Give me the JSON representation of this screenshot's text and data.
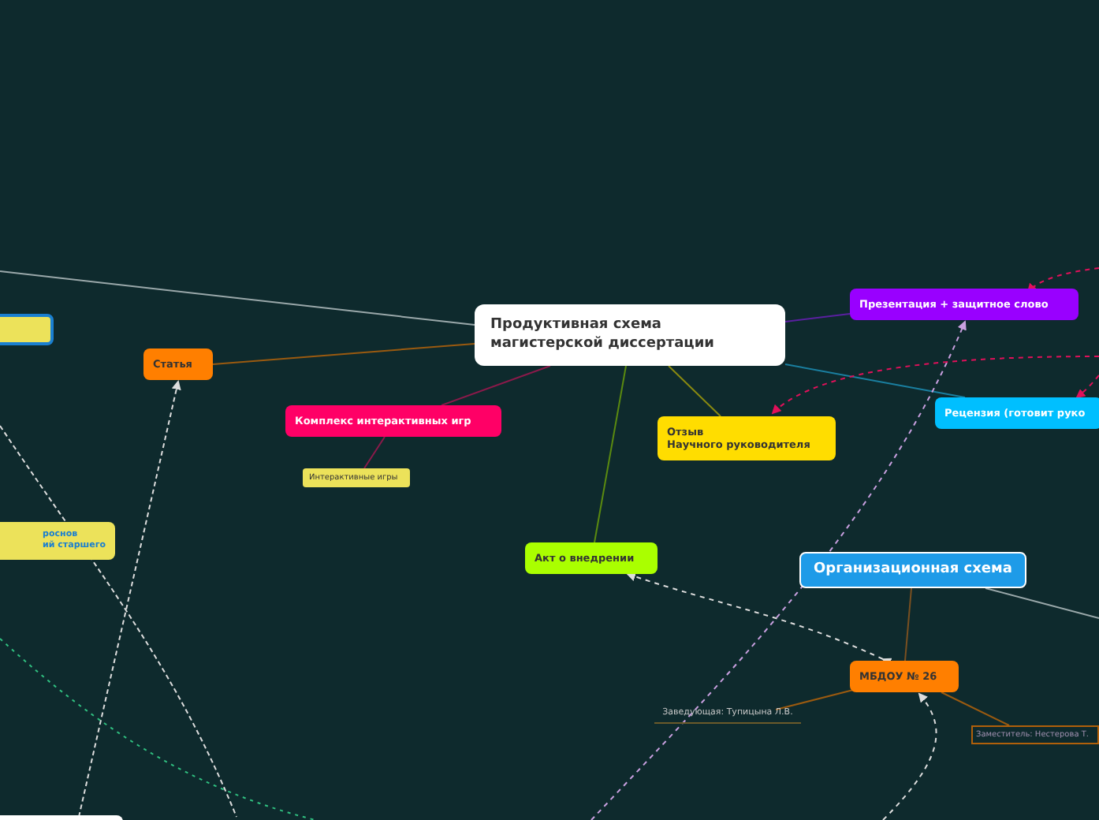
{
  "nodes": [
    {
      "kind": "main",
      "text": "Продуктивная схема\nмагистерской диссертации",
      "color": "#ffffff"
    },
    {
      "kind": "topic",
      "text": "Статья",
      "color": "#ff7f00"
    },
    {
      "kind": "topic",
      "text": "Комплекс интерактивных игр",
      "color": "#ff0066"
    },
    {
      "kind": "small",
      "text": "Интерактивные игры",
      "color": "#ece25a"
    },
    {
      "kind": "topic",
      "text": "Отзыв\nНаучного руководителя",
      "color": "#ffdd00"
    },
    {
      "kind": "topic",
      "text": "Презентация + защитное слово",
      "color": "#9900ff"
    },
    {
      "kind": "topic",
      "text": "Рецензия (готовит руко",
      "color": "#00bfff"
    },
    {
      "kind": "topic",
      "text": "Акт о внедрении",
      "color": "#aaff00"
    },
    {
      "kind": "main-blue",
      "text": "Организационная схема",
      "color": "#1e9be8"
    },
    {
      "kind": "topic",
      "text": "МБДОУ № 26",
      "color": "#ff7f00"
    },
    {
      "kind": "underline",
      "text": "Заведующая: Тупицына Л.В.",
      "color": "#6b5a2a"
    },
    {
      "kind": "outline",
      "text": "Заместитель: Нестерова Т.",
      "color": "#b0600a"
    },
    {
      "kind": "box",
      "color": "#ece25a"
    },
    {
      "kind": "note",
      "text": "роснов\nий старшего",
      "color": "#ece25a"
    },
    {
      "kind": "box",
      "color": "#ffffff"
    }
  ]
}
